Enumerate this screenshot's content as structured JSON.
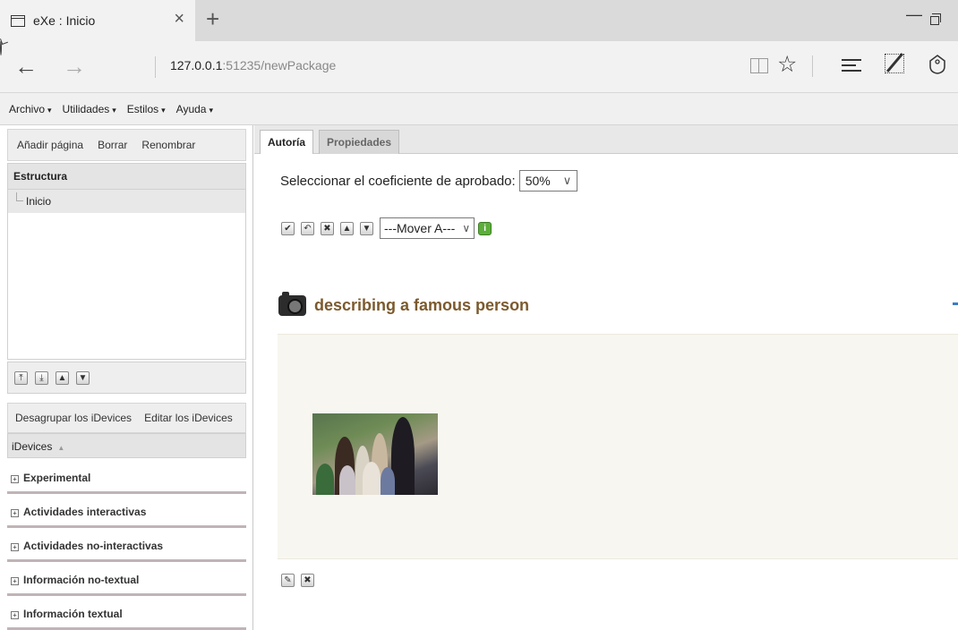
{
  "browser": {
    "tab_title": "eXe : Inicio",
    "tab_close": "×",
    "new_tab": "+",
    "url_host": "127.0.0.1",
    "url_rest": ":51235/newPackage",
    "back_glyph": "←",
    "forward_glyph": "→",
    "star_glyph": "☆",
    "minimize_glyph": "—"
  },
  "menu": {
    "items": [
      {
        "label": "Archivo"
      },
      {
        "label": "Utilidades"
      },
      {
        "label": "Estilos"
      },
      {
        "label": "Ayuda"
      }
    ],
    "caret": "▾"
  },
  "left_panel": {
    "toolbar": {
      "add_page": "Añadir página",
      "delete": "Borrar",
      "rename": "Renombrar"
    },
    "structure_heading": "Estructura",
    "tree_nodes": [
      "Inicio"
    ],
    "idevices_toolbar": {
      "ungroup": "Desagrupar los iDevices",
      "edit": "Editar los iDevices"
    },
    "idevices_heading": "iDevices",
    "idevices_toggle": "▲",
    "categories": [
      {
        "label": "Experimental"
      },
      {
        "label": "Actividades interactivas"
      },
      {
        "label": "Actividades no-interactivas"
      },
      {
        "label": "Información no-textual"
      },
      {
        "label": "Información textual"
      }
    ],
    "category_expand_glyph": "+"
  },
  "right_panel": {
    "tabs": {
      "authoring": "Autoría",
      "properties": "Propiedades"
    },
    "coefficient_label": "Seleccionar el coeficiente de aprobado:",
    "coefficient_value": "50%",
    "move_to_select": "---Mover A---",
    "select_chevron": "∨",
    "idevice_title": "describing a famous person"
  },
  "colors": {
    "idevice_title": "#7b5a2e",
    "category_separator": "#c0b4b6",
    "content_background": "#f7f6f0",
    "green_button": "#5cae3a"
  },
  "icons": {
    "action_buttons": [
      "✔",
      "↶",
      "✖",
      "▲",
      "▼"
    ],
    "move_buttons": [
      "⤒",
      "⤓",
      "▲",
      "▼"
    ],
    "green_button": "i",
    "edit_buttons": [
      "✎",
      "✖"
    ]
  }
}
